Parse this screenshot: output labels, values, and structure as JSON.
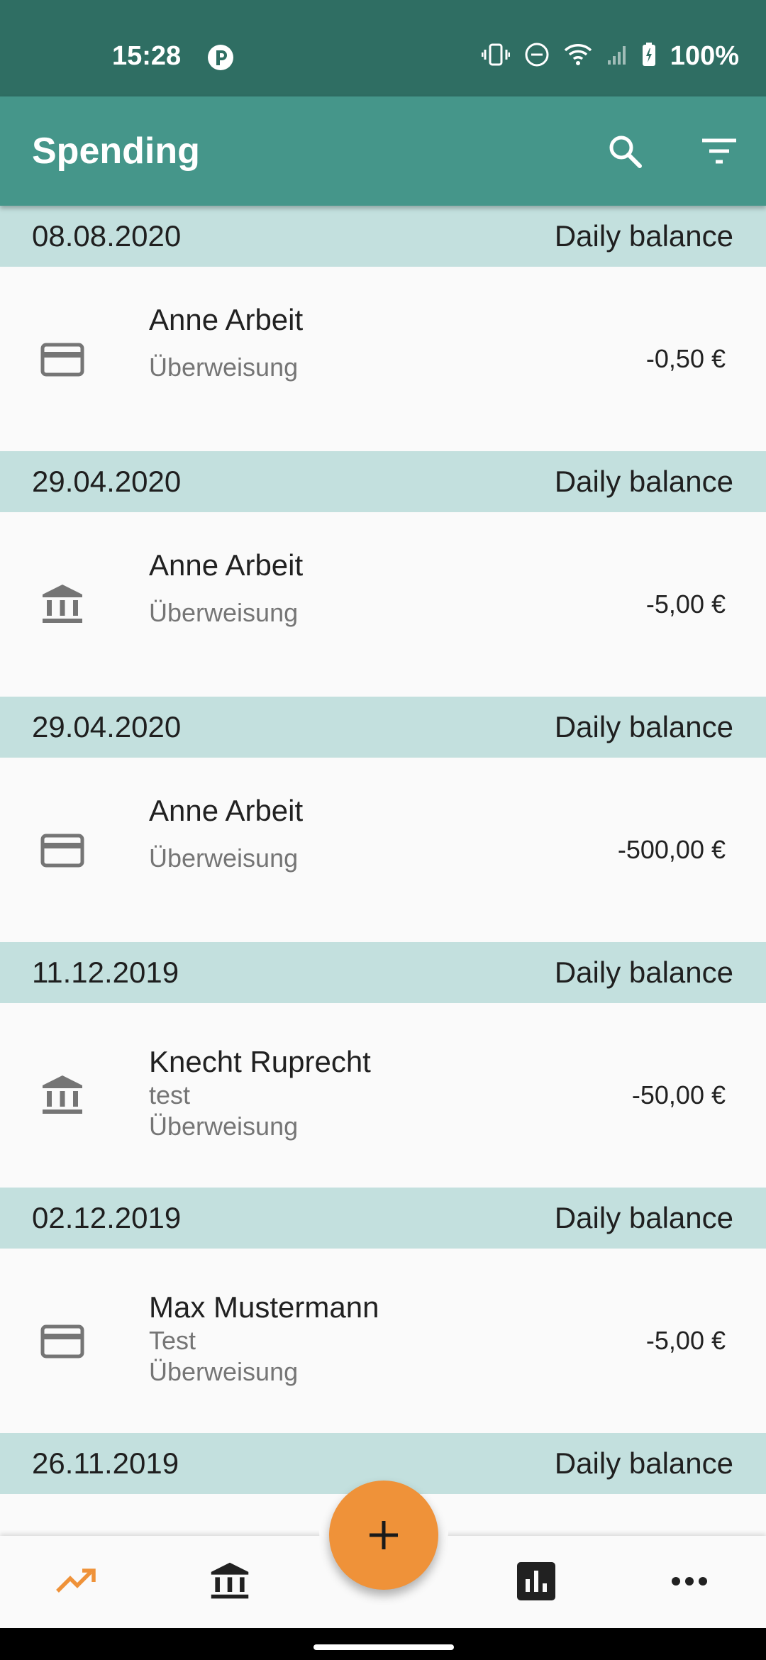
{
  "status_bar": {
    "time": "15:28",
    "battery": "100%"
  },
  "app_bar": {
    "title": "Spending",
    "actions": [
      "search-icon",
      "filter-icon"
    ]
  },
  "groups": [
    {
      "date": "08.08.2020",
      "balance_label": "Daily balance",
      "entry": {
        "icon": "credit-card-icon",
        "name": "Anne Arbeit",
        "note": "",
        "type": "Überweisung",
        "amount": "-0,50 €"
      }
    },
    {
      "date": "29.04.2020",
      "balance_label": "Daily balance",
      "entry": {
        "icon": "bank-icon",
        "name": "Anne Arbeit",
        "note": "",
        "type": "Überweisung",
        "amount": "-5,00 €"
      }
    },
    {
      "date": "29.04.2020",
      "balance_label": "Daily balance",
      "entry": {
        "icon": "credit-card-icon",
        "name": "Anne Arbeit",
        "note": "",
        "type": "Überweisung",
        "amount": "-500,00 €"
      }
    },
    {
      "date": "11.12.2019",
      "balance_label": "Daily balance",
      "entry": {
        "icon": "bank-icon",
        "name": "Knecht Ruprecht",
        "note": "test",
        "type": "Überweisung",
        "amount": "-50,00 €"
      }
    },
    {
      "date": "02.12.2019",
      "balance_label": "Daily balance",
      "entry": {
        "icon": "credit-card-icon",
        "name": "Max Mustermann",
        "note": "Test",
        "type": "Überweisung",
        "amount": "-5,00 €"
      }
    },
    {
      "date": "26.11.2019",
      "balance_label": "Daily balance"
    }
  ],
  "bottom_nav": {
    "items": [
      "trending-up-icon",
      "bank-icon",
      "bar-chart-icon",
      "more-horiz-icon"
    ],
    "active_color": "#ef9239",
    "fab_icon": "plus-icon"
  },
  "colors": {
    "status_bar": "#2f6e63",
    "app_bar": "#45968a",
    "date_header": "#c3e0de",
    "fab": "#ef9239"
  }
}
